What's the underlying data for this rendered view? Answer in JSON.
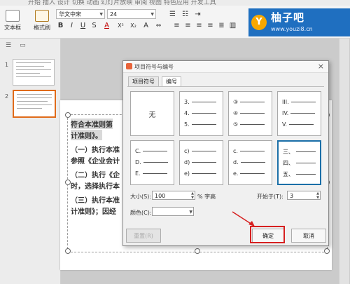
{
  "ribbon": {
    "title_fragment": "开始  插入  设计  切换  动画  幻灯片放映  审阅  视图  特色应用  开发工具",
    "textbox_label": "文本框",
    "format_brush_label": "格式刷",
    "font_name": "华文中宋",
    "font_size": "24",
    "bold": "B",
    "italic": "I",
    "underline": "U",
    "strike": "S",
    "font_color": "A",
    "clear": "A"
  },
  "watermark": {
    "circle": "Y",
    "title": "柚子吧",
    "url": "www.youzi8.cn"
  },
  "slides_panel": {
    "thumb_numbers": [
      "1",
      "2"
    ]
  },
  "slide": {
    "lines": [
      "符合本准则第",
      "计准则》。",
      "（一）执行本准",
      "参照《企业会计",
      "（二）执行《企",
      "时，选择执行本",
      "（三）执行本准",
      "计准则》；因经"
    ]
  },
  "dialog": {
    "title": "项目符号与编号",
    "close": "×",
    "tabs": [
      "项目符号",
      "编号"
    ],
    "none_label": "无",
    "cells": [
      [
        "3.",
        "4.",
        "5."
      ],
      [
        "③",
        "④",
        "⑤"
      ],
      [
        "III.",
        "IV.",
        "V."
      ],
      [
        "C.",
        "D.",
        "E."
      ],
      [
        "c)",
        "d)",
        "e)"
      ],
      [
        "c.",
        "d.",
        "e."
      ],
      [
        "三、",
        "四、",
        "五、"
      ]
    ],
    "size_label": "大小(S):",
    "size_value": "100",
    "size_unit": "% 字高",
    "start_label": "开始于(T):",
    "start_value": "3",
    "color_label": "颜色(C):",
    "reset_button": "重置(R)",
    "ok_button": "确定",
    "cancel_button": "取消"
  },
  "colors": {
    "highlight_box": "#d62020",
    "selected_cell": "#1b6fa8",
    "thumb_selected": "#e06b1a"
  }
}
